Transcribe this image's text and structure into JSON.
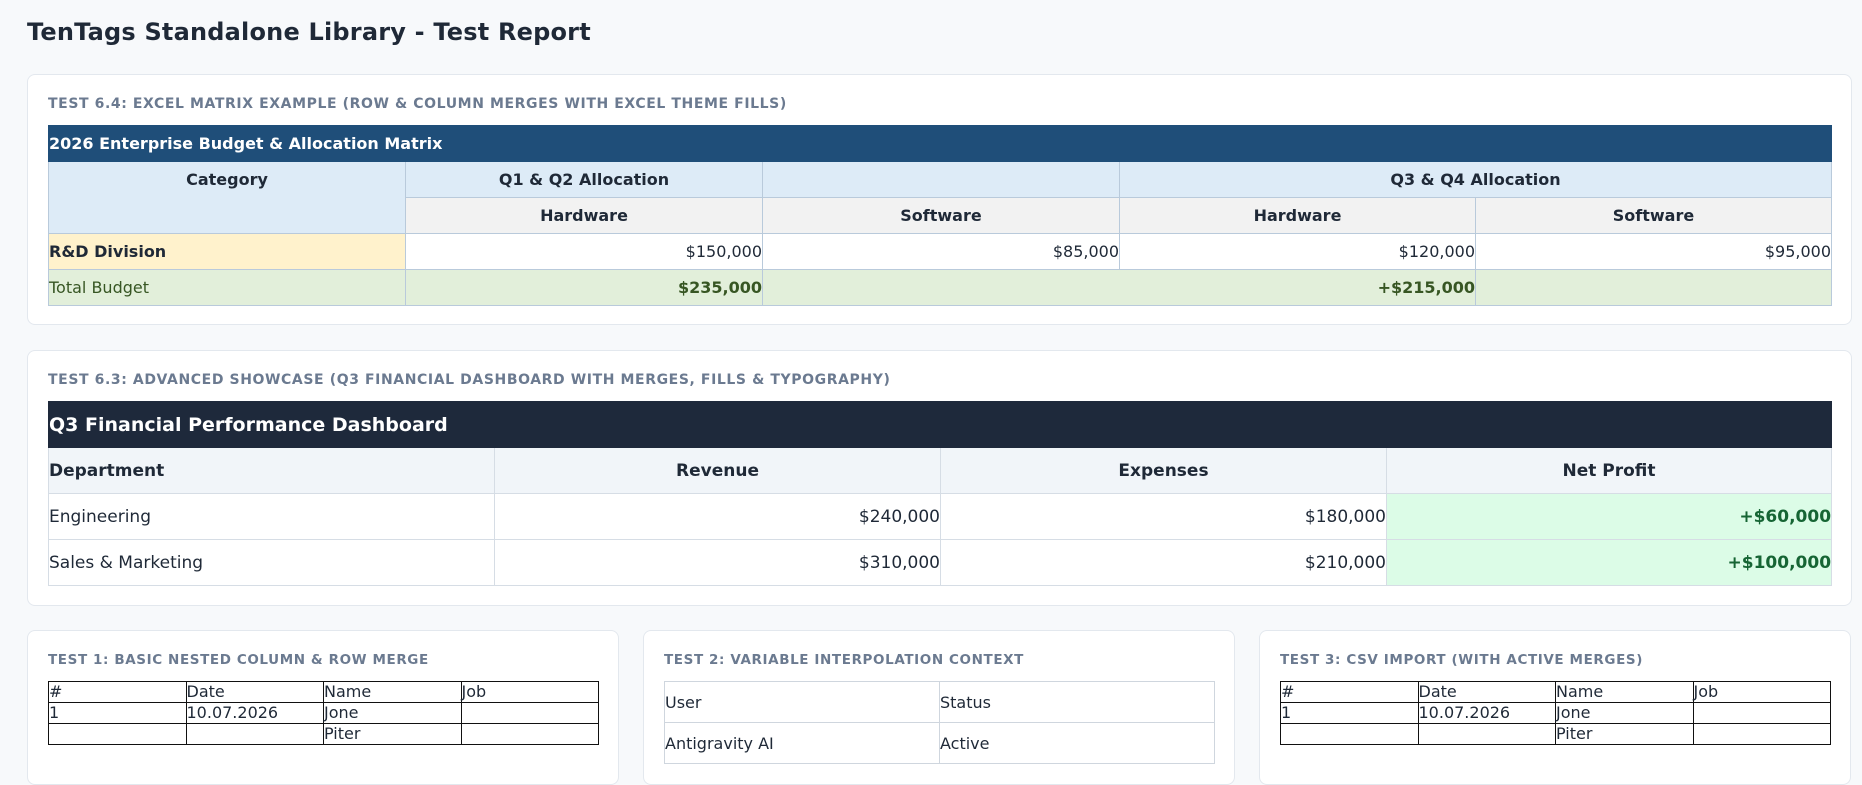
{
  "page": {
    "title": "TenTags Standalone Library - Test Report"
  },
  "excel_section": {
    "label": "TEST 6.4: EXCEL MATRIX EXAMPLE (ROW & COLUMN MERGES WITH EXCEL THEME FILLS)",
    "title": "2026 Enterprise Budget & Allocation Matrix",
    "category_header": "Category",
    "group1": "Q1 & Q2 Allocation",
    "group2": "Q3 & Q4 Allocation",
    "sub_headers": [
      "Hardware",
      "Software",
      "Hardware",
      "Software"
    ],
    "row": {
      "label": "R&D Division",
      "values": [
        "$150,000",
        "$85,000",
        "$120,000",
        "$95,000"
      ]
    },
    "total": {
      "label": "Total Budget",
      "h1": "$235,000",
      "h2": "+$215,000"
    },
    "colors": {
      "title_fill": "#1f4e79",
      "header_fill": "#ddebf7",
      "sub_fill": "#f2f2f2",
      "row_fill": "#fff2cc",
      "total_fill": "#e2efda"
    }
  },
  "dashboard_section": {
    "label": "TEST 6.3: ADVANCED SHOWCASE (Q3 FINANCIAL DASHBOARD WITH MERGES, FILLS & TYPOGRAPHY)",
    "title": "Q3 Financial Performance Dashboard",
    "headers": [
      "Department",
      "Revenue",
      "Expenses",
      "Net Profit"
    ],
    "rows": [
      {
        "department": "Engineering",
        "revenue": "$240,000",
        "expenses": "$180,000",
        "net_profit": "+$60,000"
      },
      {
        "department": "Sales & Marketing",
        "revenue": "$310,000",
        "expenses": "$210,000",
        "net_profit": "+$100,000"
      }
    ],
    "colors": {
      "title_fill": "#1e293b",
      "profit_fill": "#dcfce7",
      "profit_text": "#166534"
    }
  },
  "test1": {
    "label": "TEST 1: BASIC NESTED COLUMN & ROW MERGE",
    "headers": [
      "#",
      "Date",
      "Name",
      "Job"
    ],
    "rows": [
      [
        "1",
        "10.07.2026",
        "Jone",
        ""
      ],
      [
        "",
        "",
        "Piter",
        ""
      ]
    ]
  },
  "test2": {
    "label": "TEST 2: VARIABLE INTERPOLATION CONTEXT",
    "rows": [
      [
        "User",
        "Status"
      ],
      [
        "Antigravity AI",
        "Active"
      ]
    ]
  },
  "test3": {
    "label": "TEST 3: CSV IMPORT (WITH ACTIVE MERGES)",
    "headers": [
      "#",
      "Date",
      "Name",
      "Job"
    ],
    "rows": [
      [
        "1",
        "10.07.2026",
        "Jone",
        ""
      ],
      [
        "",
        "",
        "Piter",
        ""
      ]
    ]
  }
}
